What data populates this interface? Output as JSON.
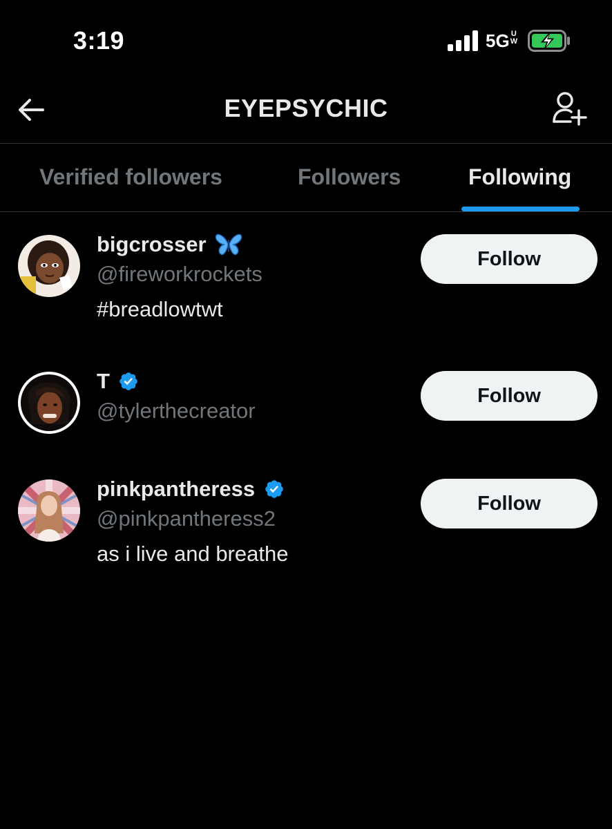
{
  "status_bar": {
    "time": "3:19",
    "network": "5G",
    "network_suffix_top": "U",
    "network_suffix_bottom": "W",
    "signal_icon": "signal-bars-icon",
    "battery_icon": "battery-charging-icon"
  },
  "header": {
    "title": "EYEPSYCHIC",
    "back_icon": "arrow-left-icon",
    "add_user_icon": "user-add-icon"
  },
  "tabs": [
    {
      "label": "Verified followers",
      "active": false
    },
    {
      "label": "Followers",
      "active": false
    },
    {
      "label": "Following",
      "active": true
    }
  ],
  "users": [
    {
      "display_name": "bigcrosser",
      "handle": "@fireworkrockets",
      "badge": "butterfly-emoji-icon",
      "bio": "#breadlowtwt",
      "button_label": "Follow"
    },
    {
      "display_name": "T",
      "handle": "@tylerthecreator",
      "badge": "verified-badge-icon",
      "bio": "",
      "button_label": "Follow"
    },
    {
      "display_name": "pinkpantheress",
      "handle": "@pinkpantheress2",
      "badge": "verified-badge-icon",
      "bio": "as i live and breathe",
      "button_label": "Follow"
    }
  ],
  "colors": {
    "background": "#000000",
    "accent": "#1d9bf0",
    "text_primary": "#e7e9ea",
    "text_secondary": "#71767b",
    "button_bg": "#eff3f4",
    "button_text": "#0f1419",
    "battery_fill": "#34c759"
  }
}
